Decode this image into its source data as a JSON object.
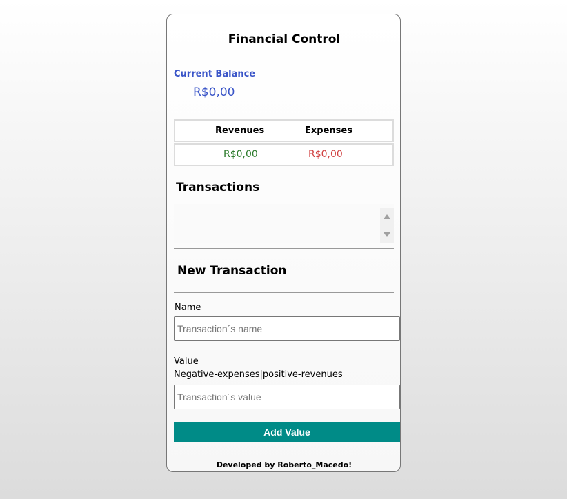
{
  "header": {
    "title": "Financial Control"
  },
  "balance": {
    "label": "Current Balance",
    "value": "R$0,00"
  },
  "summary": {
    "headers": [
      "Revenues",
      "Expenses"
    ],
    "revenues": "R$0,00",
    "expenses": "R$0,00",
    "colors": {
      "revenues": "#2a7a2a",
      "expenses": "#d04040"
    }
  },
  "transactions": {
    "title": "Transactions",
    "items": []
  },
  "new_transaction": {
    "title": "New Transaction",
    "name_label": "Name",
    "name_placeholder": "Transaction´s name",
    "value_label": "Value",
    "value_hint": "Negative-expenses|positive-revenues",
    "value_placeholder": "Transaction´s value",
    "submit_label": "Add Value"
  },
  "footer": {
    "text": "Developed by Roberto_Macedo!"
  },
  "colors": {
    "accent": "#3a55c8",
    "button": "#008b87"
  }
}
